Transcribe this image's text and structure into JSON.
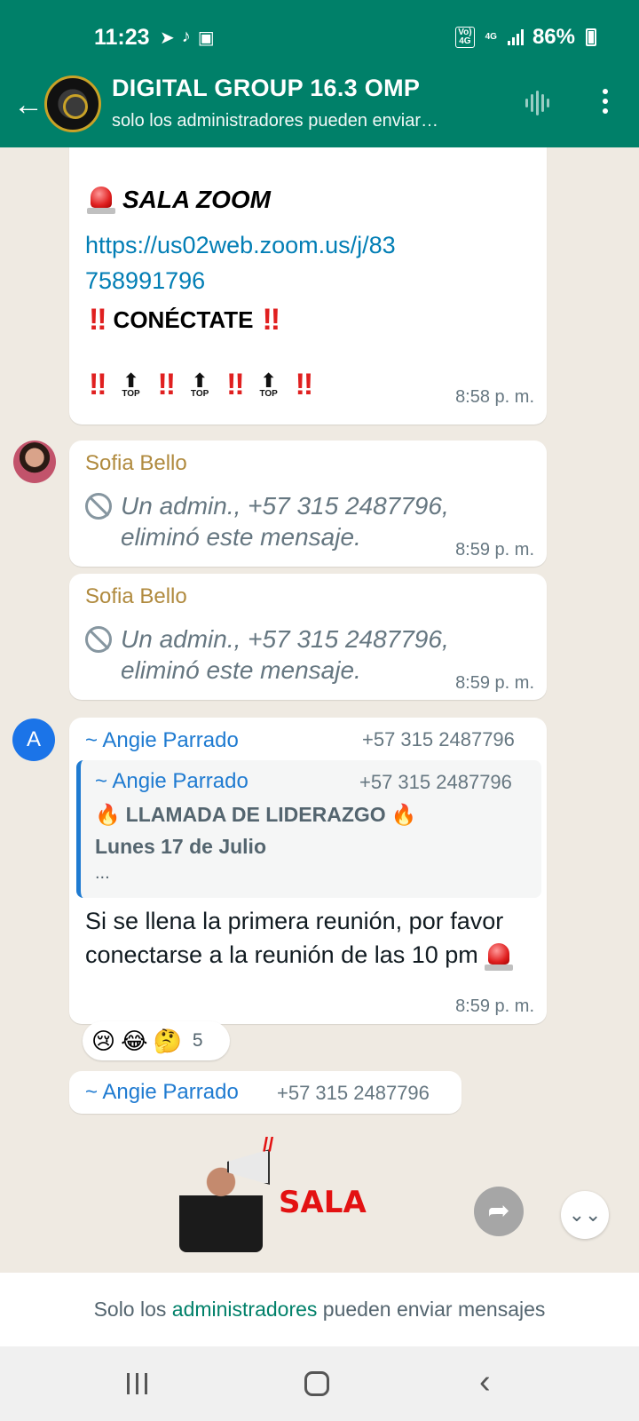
{
  "status_bar": {
    "time": "11:23",
    "battery": "86%",
    "network_badge_top": "Vo)",
    "network_badge_bottom": "4G",
    "data_label": "4G"
  },
  "header": {
    "title": "DIGITAL GROUP 16.3 OMP",
    "subtitle": "solo los administradores pueden enviar…"
  },
  "messages": {
    "zoom": {
      "heading": "SALA ZOOM",
      "link": "https://us02web.zoom.us/j/83758991796",
      "cta": "CONÉCTATE",
      "top_label": "TOP",
      "time": "8:58 p. m."
    },
    "deleted_1": {
      "sender": "Sofia Bello",
      "text": "Un admin., +57 315 2487796, eliminó este mensaje.",
      "time": "8:59 p. m."
    },
    "deleted_2": {
      "sender": "Sofia Bello",
      "text": "Un admin., +57 315 2487796, eliminó este mensaje.",
      "time": "8:59 p. m."
    },
    "angie": {
      "avatar_letter": "A",
      "sender": "~ Angie Parrado",
      "phone": "+57 315 2487796",
      "quote_sender": "~ Angie Parrado",
      "quote_phone": "+57 315 2487796",
      "quote_line1": "LLAMADA DE LIDERAZGO",
      "quote_line2": "Lunes 17 de Julio",
      "quote_line3": "...",
      "body": "Si se llena la primera reunión, por favor conectarse a la reunión de las 10 pm",
      "time": "8:59 p. m.",
      "reactions": [
        "😢",
        "😂",
        "🤔"
      ],
      "reaction_count": "5"
    },
    "angie_sticker": {
      "sender": "~ Angie Parrado",
      "phone": "+57 315 2487796",
      "sticker_text": "SALA"
    }
  },
  "footer": {
    "prefix": "Solo los ",
    "link": "administradores",
    "suffix": " pueden enviar mensajes"
  },
  "colors": {
    "brand": "#008069",
    "chat_bg": "#efeae2",
    "sender_blue": "#1f7bd1",
    "sender_gold": "#b08a3e"
  }
}
